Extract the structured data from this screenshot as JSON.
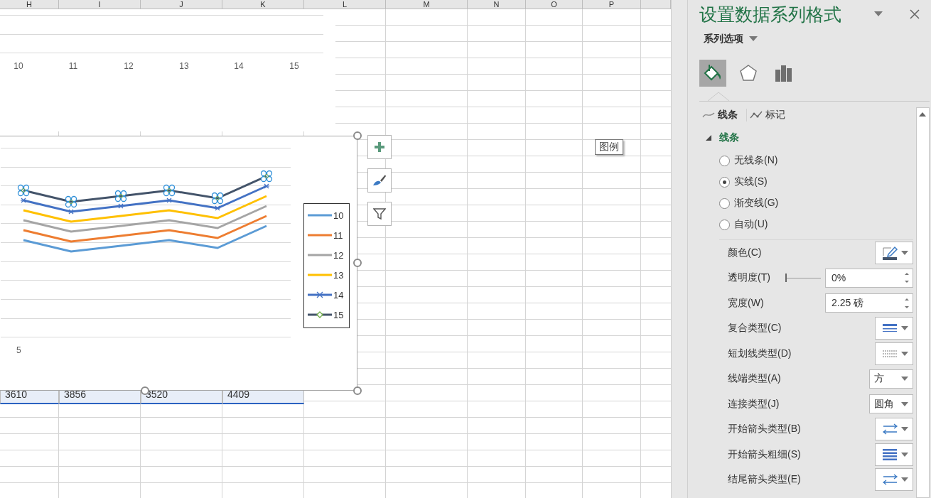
{
  "sheet": {
    "columns": [
      "H",
      "I",
      "J",
      "K",
      "L",
      "M",
      "N",
      "O",
      "P"
    ],
    "selected_range": {
      "selected": true,
      "values": [
        "3610",
        "3856",
        "3520",
        "4409"
      ]
    }
  },
  "upper_chart": {
    "x_labels": [
      "10",
      "11",
      "12",
      "13",
      "14",
      "15"
    ]
  },
  "chart": {
    "axis_label": "5",
    "lines": [
      {
        "color": "#5b9bd5",
        "kind": "plain",
        "selected": false
      },
      {
        "color": "#ed7d31",
        "kind": "plain",
        "selected": false
      },
      {
        "color": "#a5a5a5",
        "kind": "plain",
        "selected": false
      },
      {
        "color": "#ffc000",
        "kind": "plain",
        "selected": false
      },
      {
        "color": "#4472c4",
        "kind": "star",
        "selected": false
      },
      {
        "color": "#44546a",
        "kind": "diamond",
        "selected": true
      }
    ],
    "legend": [
      {
        "label": "10",
        "color": "#5b9bd5",
        "kind": "plain"
      },
      {
        "label": "11",
        "color": "#ed7d31",
        "kind": "plain"
      },
      {
        "label": "12",
        "color": "#a5a5a5",
        "kind": "plain"
      },
      {
        "label": "13",
        "color": "#ffc000",
        "kind": "plain"
      },
      {
        "label": "14",
        "color": "#4472c4",
        "kind": "star"
      },
      {
        "label": "15",
        "color": "#44546a",
        "kind": "diamond"
      }
    ]
  },
  "tooltip": "图例",
  "pane": {
    "title": "设置数据系列格式",
    "options_label": "系列选项",
    "icon_tabs": [
      {
        "kind": "fill",
        "selected": true
      },
      {
        "kind": "effects",
        "selected": false
      },
      {
        "kind": "series",
        "selected": false
      }
    ],
    "sub_tabs": [
      {
        "kind": "line",
        "label": "线条",
        "selected": true
      },
      {
        "kind": "marker",
        "label": "标记",
        "selected": false
      }
    ],
    "section": {
      "label": "线条",
      "expanded": true
    },
    "radios": [
      {
        "label": "无线条(N)",
        "selected": false
      },
      {
        "label": "实线(S)",
        "selected": true
      },
      {
        "label": "渐变线(G)",
        "selected": false
      },
      {
        "label": "自动(U)",
        "selected": false
      }
    ],
    "properties": [
      {
        "label": "颜色(C)",
        "kind": "color"
      },
      {
        "label": "透明度(T)",
        "kind": "slider",
        "level": 0,
        "value": "0%"
      },
      {
        "label": "宽度(W)",
        "kind": "spin",
        "value": "2.25 磅"
      },
      {
        "label": "复合类型(C)",
        "kind": "compound"
      },
      {
        "label": "短划线类型(D)",
        "kind": "dash"
      },
      {
        "label": "线端类型(A)",
        "kind": "select",
        "value": "方"
      },
      {
        "label": "连接类型(J)",
        "kind": "select",
        "value": "圆角"
      },
      {
        "label": "开始箭头类型(B)",
        "kind": "arrow"
      },
      {
        "label": "开始箭头粗细(S)",
        "kind": "weight"
      },
      {
        "label": "结尾箭头类型(E)",
        "kind": "arrow"
      }
    ]
  }
}
